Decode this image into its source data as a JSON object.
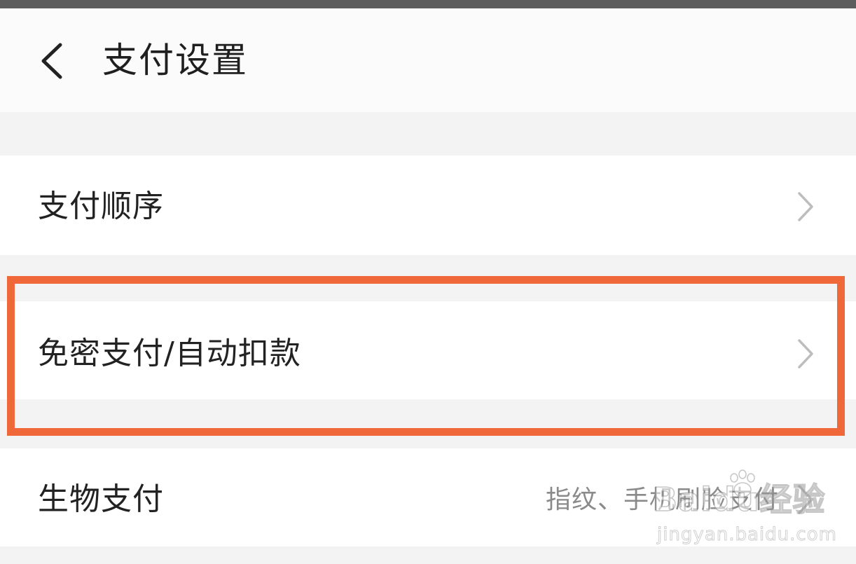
{
  "header": {
    "title": "支付设置"
  },
  "rows": [
    {
      "label": "支付顺序",
      "value": ""
    },
    {
      "label": "免密支付/自动扣款",
      "value": ""
    },
    {
      "label": "生物支付",
      "value": "指纹、手机刷脸支付"
    }
  ],
  "watermark": {
    "brand": "Baidu经验",
    "url": "jingyan.baidu.com"
  },
  "colors": {
    "highlight": "#f0683a",
    "background": "#f3f3f3",
    "row_background": "#ffffff",
    "secondary_text": "#8a8a8a"
  },
  "icons": {
    "back": "back-arrow-icon",
    "chevron": "chevron-right-icon",
    "watermark": "baidu-paw-icon"
  }
}
